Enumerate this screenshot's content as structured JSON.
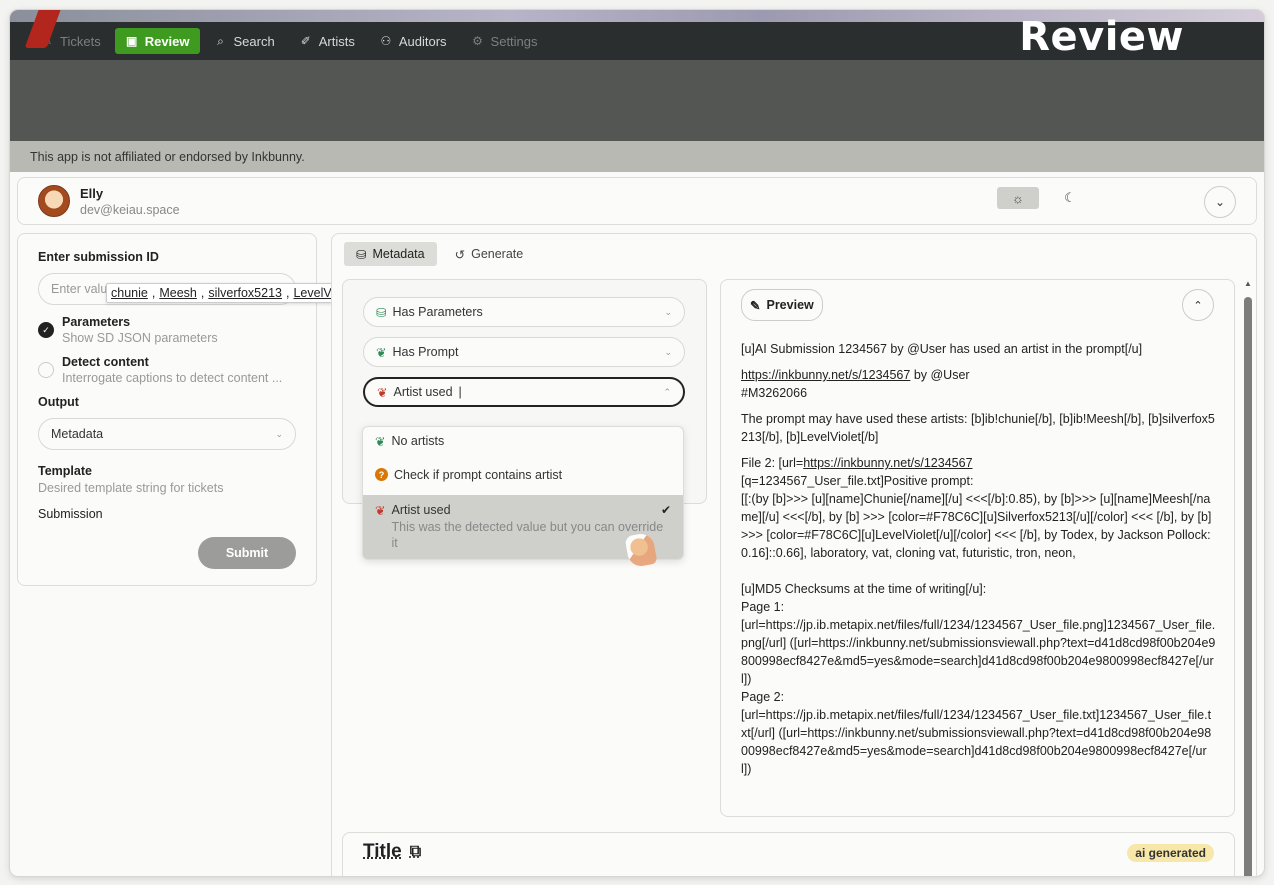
{
  "nav": {
    "items": [
      {
        "label": "Tickets",
        "icon": "ticket-icon",
        "state": "disabled"
      },
      {
        "label": "Review",
        "icon": "review-icon",
        "state": "active"
      },
      {
        "label": "Search",
        "icon": "search-icon",
        "state": "normal"
      },
      {
        "label": "Artists",
        "icon": "brush-icon",
        "state": "normal"
      },
      {
        "label": "Auditors",
        "icon": "users-icon",
        "state": "normal"
      },
      {
        "label": "Settings",
        "icon": "gear-icon",
        "state": "disabled"
      }
    ],
    "accent_color": "#3f9b1f"
  },
  "page_heading": "Review",
  "notice": "This app is not affiliated or endorsed by Inkbunny.",
  "user": {
    "name": "Elly",
    "email": "dev@keiau.space"
  },
  "form": {
    "submission_label": "Enter submission ID",
    "submission_placeholder": "Enter value",
    "options": [
      {
        "title": "Parameters",
        "desc": "Show SD JSON parameters",
        "checked": true
      },
      {
        "title": "Detect content",
        "desc": "Interrogate captions to detect content ...",
        "checked": false
      }
    ],
    "output_label": "Output",
    "output_value": "Metadata",
    "template_label": "Template",
    "template_desc": "Desired template string for tickets",
    "submission_row_label": "Submission",
    "submit_label": "Submit"
  },
  "tooltip": {
    "artists": [
      "chunie",
      "Meesh",
      "silverfox5213",
      "LevelViolet"
    ],
    "separator": ","
  },
  "tabs": [
    {
      "label": "Metadata",
      "icon": "database-icon",
      "active": true
    },
    {
      "label": "Generate",
      "icon": "history-icon",
      "active": false
    }
  ],
  "checks": [
    {
      "label": "Has Parameters",
      "icon": "database-icon"
    },
    {
      "label": "Has Prompt",
      "icon": "leaf-icon"
    },
    {
      "label": "Artist used",
      "icon": "flag-icon",
      "open": true
    }
  ],
  "dropdown": {
    "items": [
      {
        "label": "No artists",
        "icon": "leaf-icon"
      },
      {
        "label": "Check if prompt contains artist",
        "icon": "question-icon"
      },
      {
        "label": "Artist used",
        "icon": "flag-icon",
        "desc": "This was the detected value but you can override it",
        "selected": true
      }
    ]
  },
  "preview": {
    "button_label": "Preview",
    "paragraphs": [
      "[u]AI Submission 1234567 by @User has used an artist in the prompt[/u]",
      "{{link}} by @User\n#M3262066",
      "The prompt may have used these artists: [b]ib!chunie[/b], [b]ib!Meesh[/b], [b]silverfox5213[/b], [b]LevelViolet[/b]",
      "File 2: [url={{link}}\n[q=1234567_User_file.txt]Positive prompt:\n[[:(by [b]>>> [u][name]Chunie[/name][/u] <<<[/b]:0.85), by [b]>>> [u][name]Meesh[/name][/u] <<<[/b], by [b] >>> [color=#F78C6C][u]Silverfox5213[/u][/color] <<< [/b], by [b] >>> [color=#F78C6C][u]LevelViolet[/u][/color] <<< [/b], by Todex, by Jackson Pollock:0.16]::0.66], laboratory, vat, cloning vat, futuristic, tron, neon,\n\n[u]MD5 Checksums at the time of writing[/u]:\nPage 1:\n[url=https://jp.ib.metapix.net/files/full/1234/1234567_User_file.png]1234567_User_file.png[/url] ([url=https://inkbunny.net/submissionsviewall.php?text=d41d8cd98f00b204e9800998ecf8427e&md5=yes&mode=search]d41d8cd98f00b204e9800998ecf8427e[/url])\nPage 2:\n[url=https://jp.ib.metapix.net/files/full/1234/1234567_User_file.txt]1234567_User_file.txt[/url] ([url=https://inkbunny.net/submissionsviewall.php?text=d41d8cd98f00b204e9800998ecf8427e&md5=yes&mode=search]d41d8cd98f00b204e9800998ecf8427e[/url])"
    ],
    "link": "https://inkbunny.net/s/1234567"
  },
  "title_card": {
    "title": "Title",
    "badge": "ai generated",
    "badge_color": "#f7e7a8"
  }
}
